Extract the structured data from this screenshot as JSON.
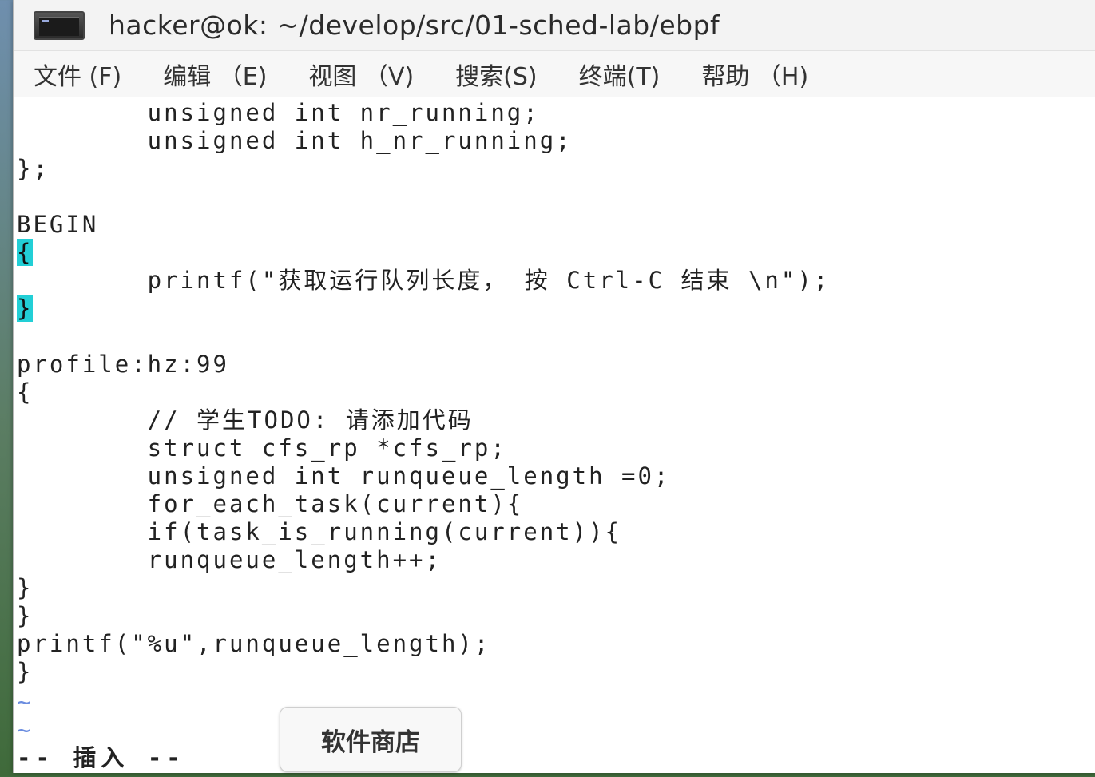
{
  "window": {
    "title": "hacker@ok: ~/develop/src/01-sched-lab/ebpf",
    "icon": "terminal-icon"
  },
  "menu": [
    {
      "label": "文件 (F)"
    },
    {
      "label": "编辑 （E)"
    },
    {
      "label": "视图 （V)"
    },
    {
      "label": "搜索(S)"
    },
    {
      "label": "终端(T)"
    },
    {
      "label": "帮助 （H)"
    }
  ],
  "editor": {
    "lines": [
      "        unsigned int nr_running;",
      "        unsigned int h_nr_running;",
      "};",
      "",
      "BEGIN",
      "{",
      "        printf(\"获取运行队列长度， 按 Ctrl-C 结束 \\n\");",
      "}",
      "",
      "profile:hz:99",
      "{",
      "        // 学生TODO: 请添加代码",
      "        struct cfs_rp *cfs_rp;",
      "        unsigned int runqueue_length =0;",
      "        for_each_task(current){",
      "        if(task_is_running(current)){",
      "        runqueue_length++;",
      "}",
      "}",
      "printf(\"%u\",runqueue_length);",
      "}",
      "~",
      "~"
    ],
    "mode_line": "-- 插入 --"
  },
  "dock_tooltip": {
    "label": "软件商店"
  },
  "colors": {
    "cursor_highlight": "#22cfd6",
    "tilde": "#6b8de0"
  }
}
